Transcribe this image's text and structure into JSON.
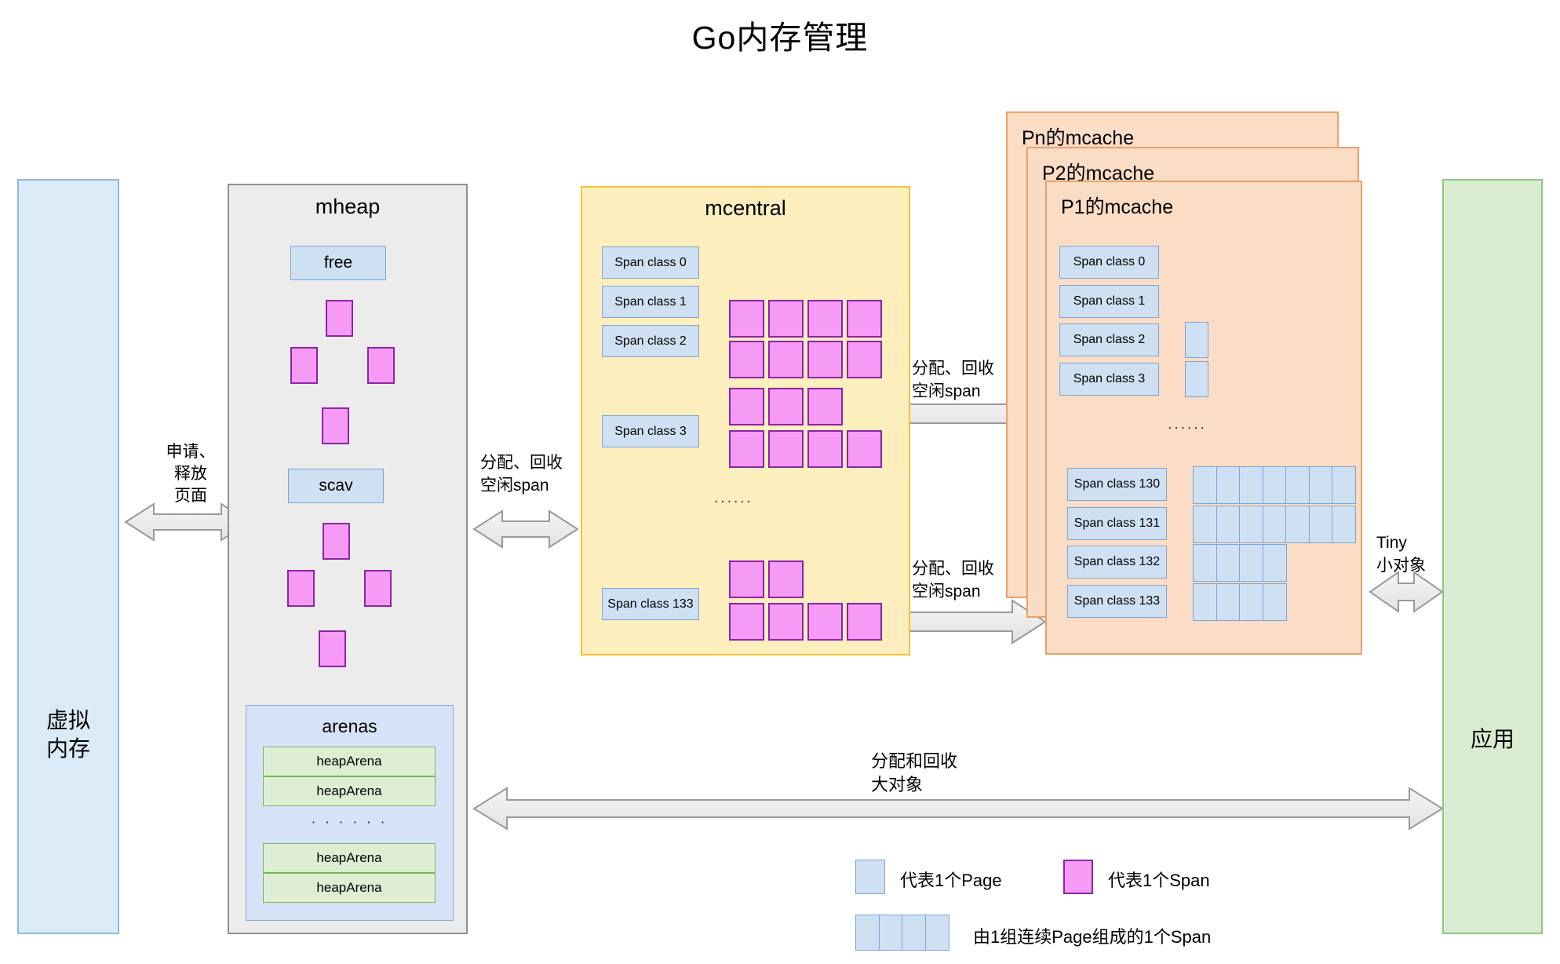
{
  "title": "Go内存管理",
  "vmem": {
    "label": "虚拟\n内存"
  },
  "vmem_label_l1": "虚拟",
  "vmem_label_l2": "内存",
  "app": {
    "label": "应用"
  },
  "mheap": {
    "title": "mheap",
    "free_label": "free",
    "scav_label": "scav",
    "arenas_title": "arenas",
    "heap_arena_label": "heapArena",
    "arena_dots": "· · · · · ·",
    "heap_arenas_top": [
      "heapArena",
      "heapArena"
    ],
    "heap_arenas_bottom": [
      "heapArena",
      "heapArena"
    ]
  },
  "mcentral": {
    "title": "mcentral",
    "classes": [
      "Span class 0",
      "Span class 1",
      "Span class 2",
      "Span class 3",
      "Span class 133"
    ],
    "dots": "......",
    "chains": {
      "class2": [
        4,
        4
      ],
      "class3": [
        3,
        4
      ],
      "class133": [
        2,
        4
      ]
    }
  },
  "mcache": {
    "captions": [
      "Pn的mcache",
      "P2的mcache",
      "P1的mcache"
    ],
    "top_classes": [
      "Span class 0",
      "Span class 1",
      "Span class 2",
      "Span class 3"
    ],
    "top_pages": [
      0,
      0,
      1,
      1
    ],
    "dots": "......",
    "bottom_classes": [
      "Span class 130",
      "Span class 131",
      "Span class 132",
      "Span class 133"
    ],
    "bottom_pages": [
      7,
      7,
      4,
      4
    ]
  },
  "arrows": {
    "vmem_mheap": "申请、\n释放\n页面",
    "vmem_mheap_l1": "申请、",
    "vmem_mheap_l2": "释放",
    "vmem_mheap_l3": "页面",
    "mheap_mcentral_l1": "分配、回收",
    "mheap_mcentral_l2": "空闲span",
    "mcentral_mcache_top_l1": "分配、回收",
    "mcentral_mcache_top_l2": "空闲span",
    "mcentral_mcache_bot_l1": "分配、回收",
    "mcentral_mcache_bot_l2": "空闲span",
    "mcache_app_l1": "Tiny",
    "mcache_app_l2": "小对象",
    "big_object_l1": "分配和回收",
    "big_object_l2": "大对象"
  },
  "legend": {
    "page": "代表1个Page",
    "span": "代表1个Span",
    "span_group": "由1组连续Page组成的1个Span"
  },
  "colors": {
    "vmem_fill": "#dbeaf7",
    "app_fill": "#d9ecd2",
    "mheap_fill": "#ececec",
    "mcentral_fill": "#fdeebd",
    "mcache_fill": "#fbdcc5",
    "page_fill": "#cfe0f2",
    "span_fill": "#f59bf5",
    "arena_fill": "#ddeed2"
  }
}
